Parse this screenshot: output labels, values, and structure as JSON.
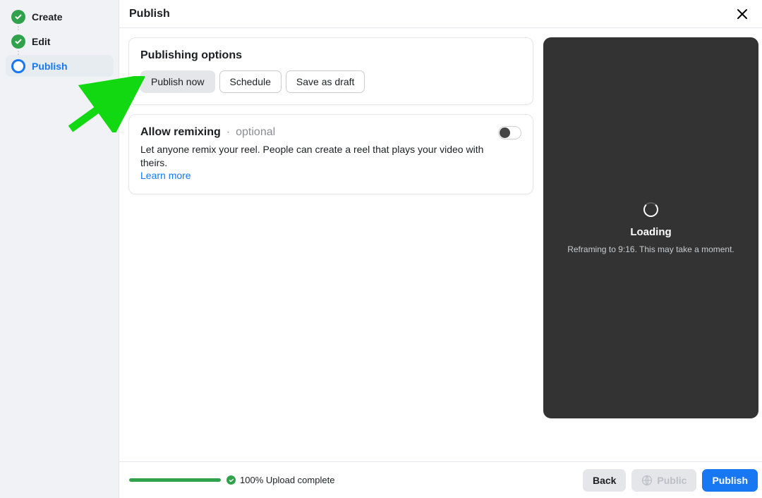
{
  "sidebar": {
    "steps": [
      {
        "label": "Create",
        "state": "done"
      },
      {
        "label": "Edit",
        "state": "done"
      },
      {
        "label": "Publish",
        "state": "active"
      }
    ]
  },
  "header": {
    "title": "Publish"
  },
  "publishingOptions": {
    "title": "Publishing options",
    "options": [
      "Publish now",
      "Schedule",
      "Save as draft"
    ],
    "selected": "Publish now"
  },
  "remix": {
    "title": "Allow remixing",
    "optional": "optional",
    "description": "Let anyone remix your reel. People can create a reel that plays your video with theirs.",
    "learnMore": "Learn more",
    "enabled": false
  },
  "preview": {
    "loading": "Loading",
    "subtext": "Reframing to 9:16. This may take a moment."
  },
  "footer": {
    "uploadPercent": 100,
    "uploadLabel": "100% Upload complete",
    "back": "Back",
    "privacy": "Public",
    "publish": "Publish"
  }
}
